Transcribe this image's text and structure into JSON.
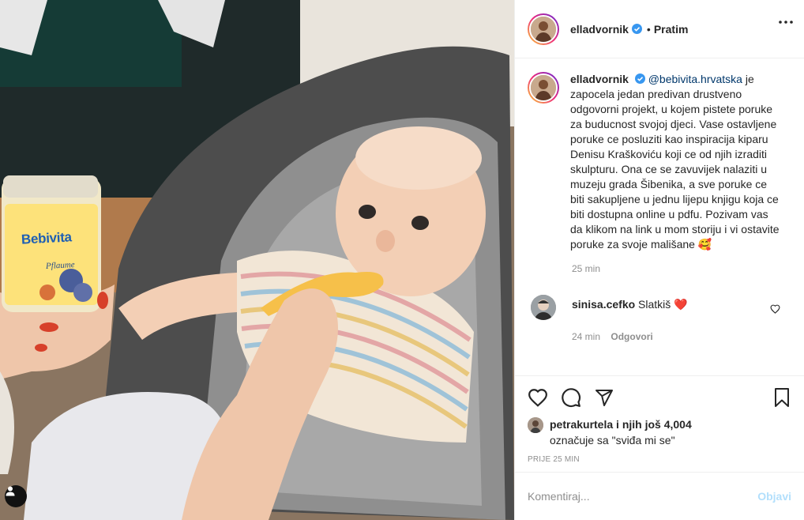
{
  "post": {
    "author": "elladvornik",
    "follow_label": "Pratim",
    "dot": "•",
    "caption": {
      "user": "elladvornik",
      "mention": "@bebivita.hrvatska",
      "text": "je zapocela jedan predivan drustveno odgovorni projekt, u kojem pistete poruke za buducnost svojoj djeci. Vase ostavljene poruke ce posluziti kao inspiracija kiparu Denisu Kraškoviću koji ce od njih izraditi skulpturu. Ona ce se zavuvijek nalaziti u muzeju grada Šibenika, a sve poruke ce biti sakupljene u jednu lijepu knjigu koja ce biti dostupna online u pdfu. Pozivam vas da klikom na link u mom storiju i vi ostavite poruke za svoje mališane",
      "emoji": "🥰",
      "time": "25 min"
    },
    "comments": [
      {
        "user": "sinisa.cefko",
        "text": "Slatkiš",
        "emoji": "❤️",
        "time": "24 min",
        "reply_label": "Odgovori"
      }
    ],
    "likes": {
      "liker": "petrakurtela",
      "rest": "i njih još 4,004",
      "line2": "označuje sa \"sviđa mi se\""
    },
    "posted_ago": "PRIJE 25 MIN",
    "add_comment": {
      "placeholder": "Komentiraj...",
      "post_label": "Objavi"
    },
    "photo": {
      "jar_brand": "Bebivita",
      "jar_flavor": "Pflaume"
    }
  },
  "icons": {
    "verified": "verified-badge-icon",
    "more": "more-options-icon",
    "like": "heart-icon",
    "comment": "comment-bubble-icon",
    "share": "paper-plane-icon",
    "save": "bookmark-icon",
    "tag": "user-tag-icon"
  },
  "colors": {
    "verified": "#3897f0",
    "heart": "#ed4956",
    "link": "#00376b",
    "post_button_disabled": "#b2dffc"
  }
}
